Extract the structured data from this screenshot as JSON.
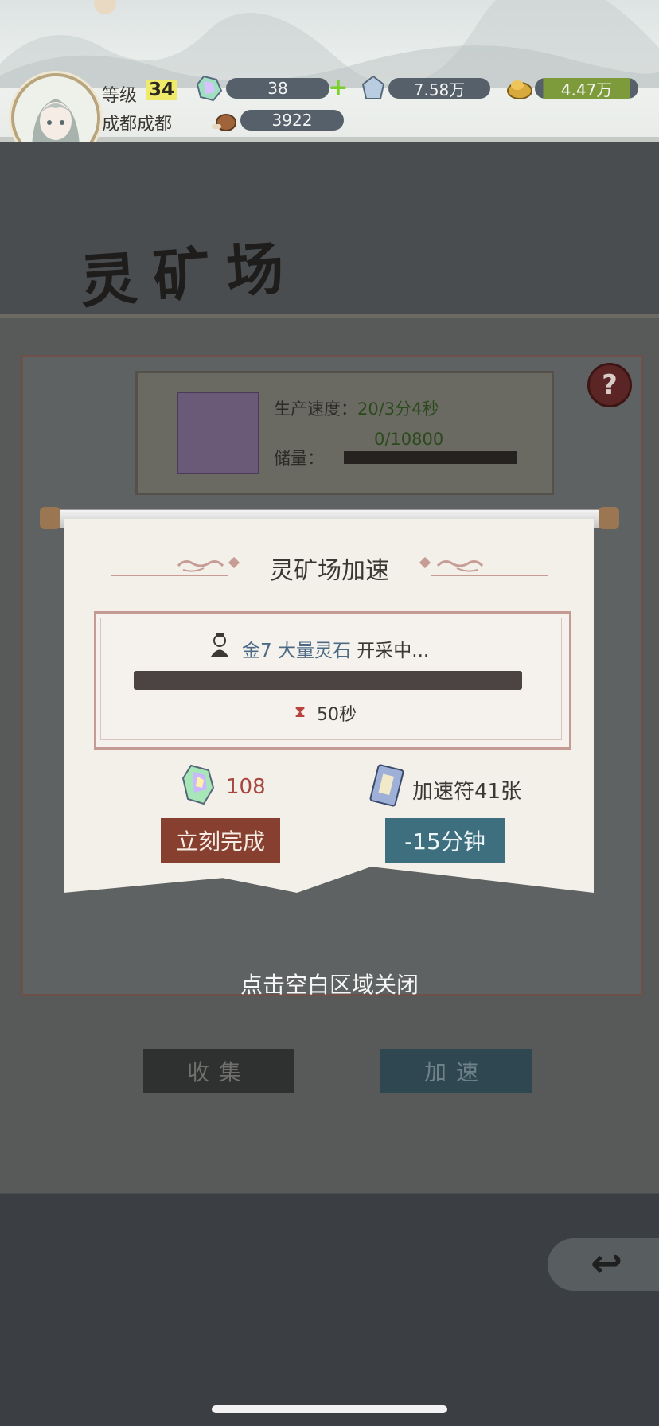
{
  "hud": {
    "level_label": "等级",
    "level": "34",
    "player_name": "成都成都",
    "gems": "38",
    "crystals": "7.58万",
    "ore": "4.47万",
    "meat": "3922",
    "plus": "+"
  },
  "scene": {
    "title": "灵矿场",
    "rate_label": "生产速度：",
    "rate_value": "20/3分4秒",
    "storage_label": "储量：",
    "storage_value": "0/10800",
    "help": "?",
    "collect_button": "收集",
    "speed_button": "加速"
  },
  "modal": {
    "title": "灵矿场加速",
    "worker_grade": "金7",
    "worker_task": "大量灵石",
    "status": "开采中...",
    "time_left": "50秒",
    "gem_cost": "108",
    "ticket_text": "加速符41张",
    "finish_button": "立刻完成",
    "reduce_button": "-15分钟",
    "progress": 0.0
  },
  "close_hint": "点击空白区域关闭",
  "colors": {
    "finish": "#87402f",
    "reduce": "#3d6f7f",
    "accent_red": "#a8463f"
  }
}
